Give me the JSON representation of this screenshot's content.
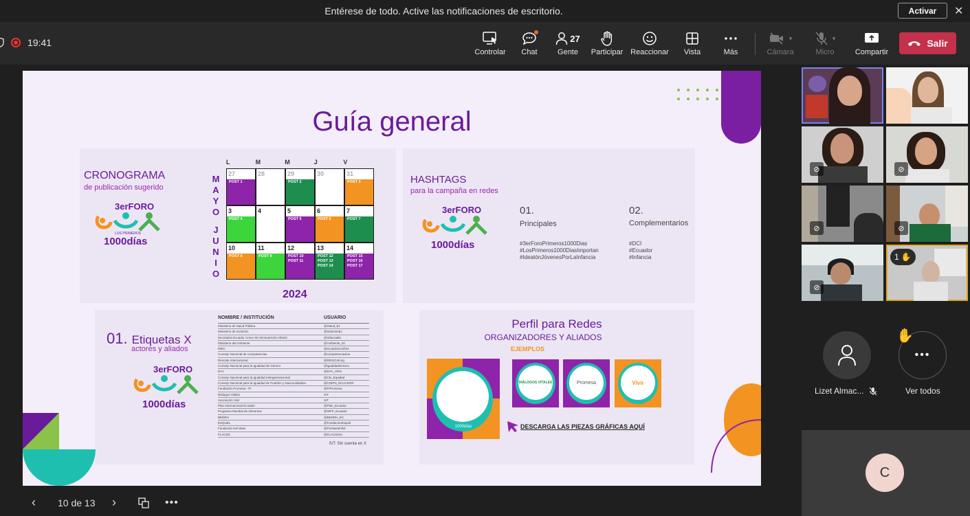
{
  "notification": {
    "message": "Entérese de todo. Active las notificaciones de escritorio.",
    "activate_label": "Activar",
    "close_glyph": "✕"
  },
  "meeting": {
    "elapsed": "19:41"
  },
  "toolbar": [
    {
      "label": "Controlar",
      "icon": "monitor-pointer-icon"
    },
    {
      "label": "Chat",
      "icon": "chat-icon"
    },
    {
      "label": "Gente",
      "icon": "people-icon",
      "count": "27"
    },
    {
      "label": "Participar",
      "icon": "raise-hand-icon"
    },
    {
      "label": "Reaccionar",
      "icon": "smiley-icon"
    },
    {
      "label": "Vista",
      "icon": "grid-view-icon"
    },
    {
      "label": "Más",
      "icon": "more-icon"
    },
    {
      "label": "Cámara",
      "icon": "camera-off-icon"
    },
    {
      "label": "Micro",
      "icon": "mic-off-icon"
    },
    {
      "label": "Compartir",
      "icon": "share-icon"
    }
  ],
  "leave_label": "Salir",
  "slide": {
    "title": "Guía general",
    "cronograma": {
      "heading": "CRONOGRAMA",
      "subheading": "de publicación sugerido",
      "logo_foro": "3erFORO",
      "logo_primeros": "LOS PRIMEROS",
      "logo_1000": "1000días",
      "days": [
        "L",
        "M",
        "M",
        "J",
        "V"
      ],
      "month_mayo": [
        "M",
        "A",
        "Y",
        "O"
      ],
      "month_junio": [
        "J",
        "U",
        "N",
        "I",
        "O"
      ],
      "year": "2024",
      "rows": [
        [
          {
            "n": "27",
            "posts": [
              "POST 1"
            ],
            "c": "#8e24aa",
            "dim": true
          },
          {
            "n": "28",
            "posts": [],
            "c": "#fff",
            "dim": true
          },
          {
            "n": "29",
            "posts": [
              "POST 2"
            ],
            "c": "#1e8e4e",
            "dim": true
          },
          {
            "n": "30",
            "posts": [],
            "c": "#fff",
            "dim": true
          },
          {
            "n": "31",
            "posts": [
              "POST 3"
            ],
            "c": "#f39321",
            "dim": true
          }
        ],
        [
          {
            "n": "3",
            "posts": [
              "POST 4"
            ],
            "c": "#3cd63c"
          },
          {
            "n": "4",
            "posts": [],
            "c": "#fff"
          },
          {
            "n": "5",
            "posts": [
              "POST 5"
            ],
            "c": "#8e24aa"
          },
          {
            "n": "6",
            "posts": [
              "POST 6"
            ],
            "c": "#f39321"
          },
          {
            "n": "7",
            "posts": [
              "POST 7"
            ],
            "c": "#1e8e4e"
          }
        ],
        [
          {
            "n": "10",
            "posts": [
              "POST 8"
            ],
            "c": "#f39321"
          },
          {
            "n": "11",
            "posts": [
              "POST 9"
            ],
            "c": "#3cd63c"
          },
          {
            "n": "12",
            "posts": [
              "POST 10",
              "POST 11"
            ],
            "c": "#8e24aa"
          },
          {
            "n": "13",
            "posts": [
              "POST 12",
              "POST 13",
              "POST 14"
            ],
            "c": "#1e8e4e"
          },
          {
            "n": "14",
            "posts": [
              "POST 15",
              "POST 16",
              "POST 17"
            ],
            "c": "#8e24aa"
          }
        ]
      ]
    },
    "hashtags": {
      "heading": "HASHTAGS",
      "subheading": "para la campaña en redes",
      "col1_num": "01.",
      "col1_title": "Principales",
      "col1_items": [
        "#3erForoPrimeros1000Dias",
        "#LosPrimeros1000DiasImportan",
        "#IdeatónJóvenesPorLaInfancia"
      ],
      "col2_num": "02.",
      "col2_title": "Complementarios",
      "col2_items": [
        "#DCI",
        "#Ecuador",
        "#Infancia"
      ]
    },
    "etiquetas": {
      "num": "01.",
      "heading": "Etiquetas X",
      "subheading": "actores y aliados",
      "col_name": "NOMBRE / INSTITUCIÓN",
      "col_user": "USUARIO",
      "rows": [
        [
          "Ministerio de Salud Pública",
          "@Salud_Ec"
        ],
        [
          "Ministerio de Inclusión",
          "@IndusionEc"
        ],
        [
          "Secretaría Ecuador Crece Sin Desnutrición Infantil",
          "@InfanciaEc"
        ],
        [
          "Ministerio del Ambiente",
          "@Ambiente_Ec"
        ],
        [
          "INEC",
          "@ecuadorencifras"
        ],
        [
          "Consejo Nacional de Competencias",
          "@competenciasine"
        ],
        [
          "Rescate Internacional",
          "@RESCUEorg"
        ],
        [
          "Consejo Nacional para la Igualdad de Género",
          "@IgualdadGenero"
        ],
        [
          "DYA",
          "@DYA_ORG"
        ],
        [
          "Consejo Nacional para la Igualdad Intergeneracional",
          "@CN_Equidad"
        ],
        [
          "Consejo Nacional para la Igualdad de Pueblos y Nacionalidades",
          "@CNIPN_ECUADOR"
        ],
        [
          "Fundación Promesa - PI",
          "@PiPromesa"
        ],
        [
          "Diálogos Vitales",
          "S/T"
        ],
        [
          "Asociación Vivir",
          "S/T"
        ],
        [
          "Plan Internacional Ecuador",
          "@Plan_Ecuador"
        ],
        [
          "Programa Mundial de Alimentos",
          "@WFP_Ecuador"
        ],
        [
          "BEDRH",
          "@BEDRH_EC"
        ],
        [
          "ESQUEL",
          "@FundacionEsquel"
        ],
        [
          "Fundación Del Wasi",
          "@PoriNetaFdW"
        ],
        [
          "FLACSO",
          "@FLACSOec"
        ]
      ],
      "footnote": "S/T: Sin cuenta en X"
    },
    "perfil": {
      "heading": "Perfil para Redes",
      "subheading": "ORGANIZADORES Y ALIADOS",
      "ejemplos": "EJEMPLOS",
      "badge1": "DIÁLOGOS VITALES",
      "badge2": "Promesa",
      "badge3": "Vivir",
      "badge_logo": "1000días",
      "download": "DESCARGA LAS PIEZAS GRÁFICAS AQUÍ"
    }
  },
  "pager": {
    "label": "10 de 13"
  },
  "participants": {
    "visible_name": "Lizet Almac...",
    "see_all": "Ver todos",
    "hand_count": "1",
    "bottom_initial": "C"
  },
  "colors": {
    "brand_purple": "#6a1b9a",
    "orange": "#f39321",
    "green": "#1e8e4e",
    "teal": "#1fbfb0",
    "leave_red": "#c4314b",
    "hand_yellow": "#e3a720"
  }
}
